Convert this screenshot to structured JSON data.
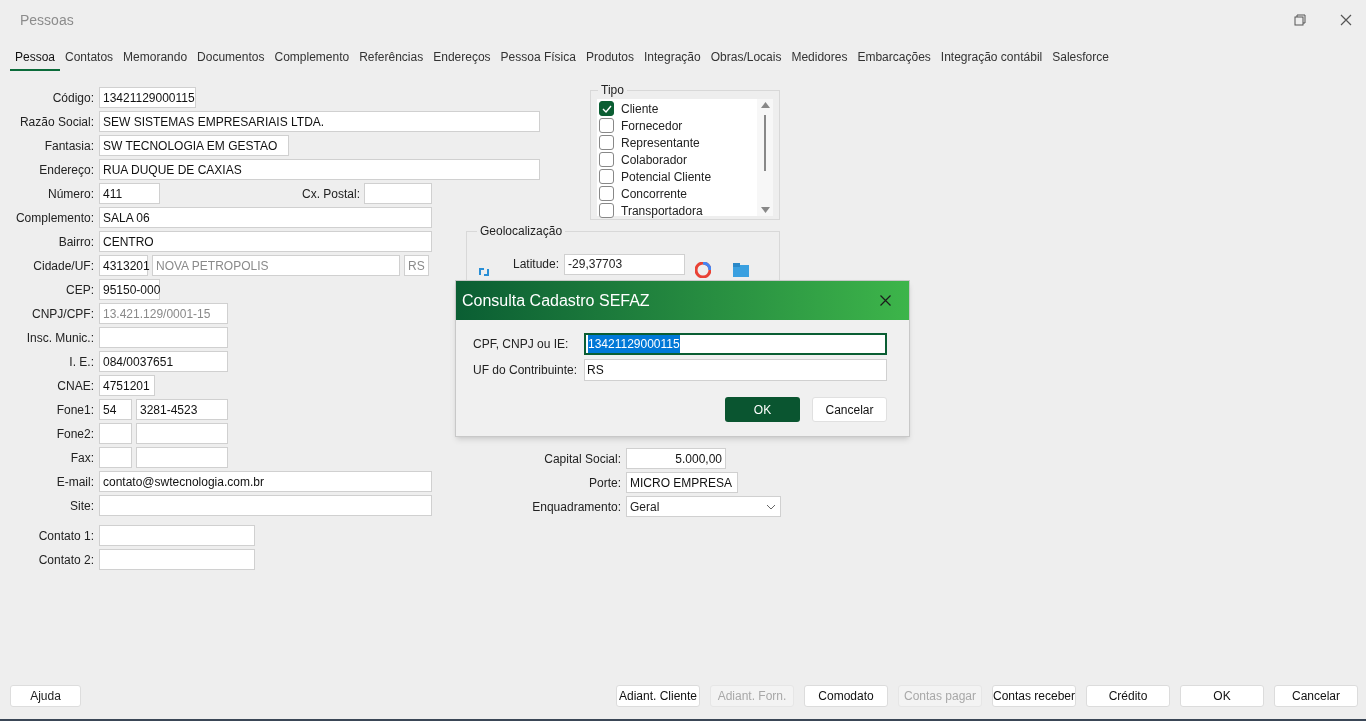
{
  "window": {
    "title": "Pessoas"
  },
  "tabs": [
    {
      "label": "Pessoa",
      "selected": true
    },
    {
      "label": "Contatos",
      "selected": false
    },
    {
      "label": "Memorando",
      "selected": false
    },
    {
      "label": "Documentos",
      "selected": false
    },
    {
      "label": "Complemento",
      "selected": false
    },
    {
      "label": "Referências",
      "selected": false
    },
    {
      "label": "Endereços",
      "selected": false
    },
    {
      "label": "Pessoa Física",
      "selected": false
    },
    {
      "label": "Produtos",
      "selected": false
    },
    {
      "label": "Integração",
      "selected": false
    },
    {
      "label": "Obras/Locais",
      "selected": false
    },
    {
      "label": "Medidores",
      "selected": false
    },
    {
      "label": "Embarcações",
      "selected": false
    },
    {
      "label": "Integração contábil",
      "selected": false
    },
    {
      "label": "Salesforce",
      "selected": false
    }
  ],
  "fields": [
    {
      "label": "Código:",
      "inputs": [
        {
          "value": "13421129000115",
          "disabled": false
        }
      ]
    },
    {
      "label": "Razão Social:",
      "inputs": [
        {
          "value": "SEW SISTEMAS EMPRESARIAIS LTDA.",
          "disabled": false
        }
      ]
    },
    {
      "label": "Fantasia:",
      "inputs": [
        {
          "value": "SW TECNOLOGIA EM GESTAO",
          "disabled": false
        }
      ]
    },
    {
      "label": "Endereço:",
      "inputs": [
        {
          "value": "RUA DUQUE DE CAXIAS",
          "disabled": false
        }
      ]
    },
    {
      "label": "Número:",
      "inputs": [
        {
          "value": "411",
          "disabled": false
        }
      ],
      "extra": {
        "label": "Cx. Postal:"
      }
    },
    {
      "label": "Complemento:",
      "inputs": [
        {
          "value": "SALA 06",
          "disabled": false
        }
      ]
    },
    {
      "label": "Bairro:",
      "inputs": [
        {
          "value": "CENTRO",
          "disabled": false
        }
      ]
    },
    {
      "label": "Cidade/UF:",
      "inputs": [
        {
          "value": "4313201",
          "disabled": false
        },
        {
          "value": "NOVA PETROPOLIS",
          "disabled": true
        },
        {
          "value": "RS",
          "disabled": true
        }
      ]
    },
    {
      "label": "CEP:",
      "inputs": [
        {
          "value": "95150-000",
          "disabled": false
        }
      ]
    },
    {
      "label": "CNPJ/CPF:",
      "inputs": [
        {
          "value": "13.421.129/0001-15",
          "disabled": true
        }
      ]
    },
    {
      "label": "Insc. Munic.:"
    },
    {
      "label": "I. E.:",
      "inputs": [
        {
          "value": "084/0037651",
          "disabled": false
        }
      ]
    },
    {
      "label": "CNAE:",
      "inputs": [
        {
          "value": "4751201",
          "disabled": false
        }
      ]
    },
    {
      "label": "Fone1:",
      "inputs": [
        {
          "value": "54",
          "disabled": false
        },
        {
          "value": "3281-4523",
          "disabled": false
        }
      ]
    },
    {
      "label": "Fone2:"
    },
    {
      "label": "Fax:"
    },
    {
      "label": "E-mail:",
      "inputs": [
        {
          "value": "contato@swtecnologia.com.br",
          "disabled": false
        }
      ]
    },
    {
      "label": "Site:"
    },
    {
      "label": "Contato 1:"
    },
    {
      "label": "Contato 2:"
    }
  ],
  "tipo": {
    "title": "Tipo",
    "items": [
      {
        "label": "Cliente",
        "checked": true
      },
      {
        "label": "Fornecedor",
        "checked": false
      },
      {
        "label": "Representante",
        "checked": false
      },
      {
        "label": "Colaborador",
        "checked": false
      },
      {
        "label": "Potencial Cliente",
        "checked": false
      },
      {
        "label": "Concorrente",
        "checked": false
      },
      {
        "label": "Transportadora",
        "checked": false
      }
    ]
  },
  "geolocalizacao": {
    "title": "Geolocalização",
    "latitude_label": "Latitude:",
    "latitude": "-29,37703"
  },
  "company": [
    {
      "kind": "number",
      "label": "Capital Social:",
      "value": "5.000,00"
    },
    {
      "kind": "text",
      "label": "Porte:",
      "value": "MICRO EMPRESA"
    },
    {
      "kind": "select",
      "label": "Enquadramento:",
      "value": "Geral"
    }
  ],
  "dialog": {
    "title": "Consulta Cadastro SEFAZ",
    "fields": [
      {
        "label": "CPF, CNPJ ou IE:",
        "value": "13421129000115",
        "focused": true
      },
      {
        "label": "UF do Contribuinte:",
        "value": "RS",
        "focused": false
      }
    ],
    "buttons": [
      {
        "label": "OK",
        "primary": true
      },
      {
        "label": "Cancelar",
        "primary": false
      }
    ]
  },
  "footer": {
    "help": "Ajuda",
    "buttons": [
      {
        "label": "Adiant. Cliente",
        "disabled": false
      },
      {
        "label": "Adiant. Forn.",
        "disabled": true
      },
      {
        "label": "Comodato",
        "disabled": false
      },
      {
        "label": "Contas pagar",
        "disabled": true
      },
      {
        "label": "Contas receber",
        "disabled": false
      },
      {
        "label": "Crédito",
        "disabled": false
      },
      {
        "label": "OK",
        "disabled": false
      },
      {
        "label": "Cancelar",
        "disabled": false
      }
    ]
  }
}
